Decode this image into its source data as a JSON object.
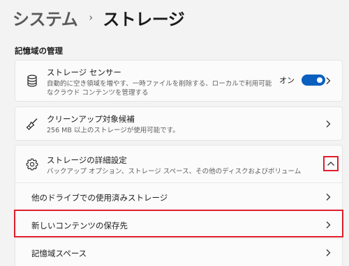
{
  "breadcrumb": {
    "parent": "システム",
    "separator": "›",
    "current": "ストレージ"
  },
  "section": {
    "title": "記憶域の管理"
  },
  "storage_sense": {
    "title": "ストレージ センサー",
    "description": "自動的に空き領域を増やす、一時ファイルを削除する、ローカルで利用可能なクラウド コンテンツを管理する",
    "toggle_label": "オン",
    "toggle_on": true,
    "icon": "storage-drive-icon"
  },
  "cleanup": {
    "title": "クリーンアップ対象候補",
    "description": "256 MB 以上のストレージが使用可能です。",
    "icon": "broom-icon"
  },
  "advanced": {
    "title": "ストレージの詳細設定",
    "description": "バックアップ オプション、ストレージ スペース、その他のディスクおよびボリューム",
    "icon": "gear-icon",
    "expanded": true,
    "items": [
      {
        "label": "他のドライブでの使用済みストレージ"
      },
      {
        "label": "新しいコンテンツの保存先"
      },
      {
        "label": "記憶域スペース"
      }
    ]
  },
  "colors": {
    "accent": "#0a5fbf",
    "highlight": "#e01e2b",
    "background": "#f3f3f3"
  }
}
